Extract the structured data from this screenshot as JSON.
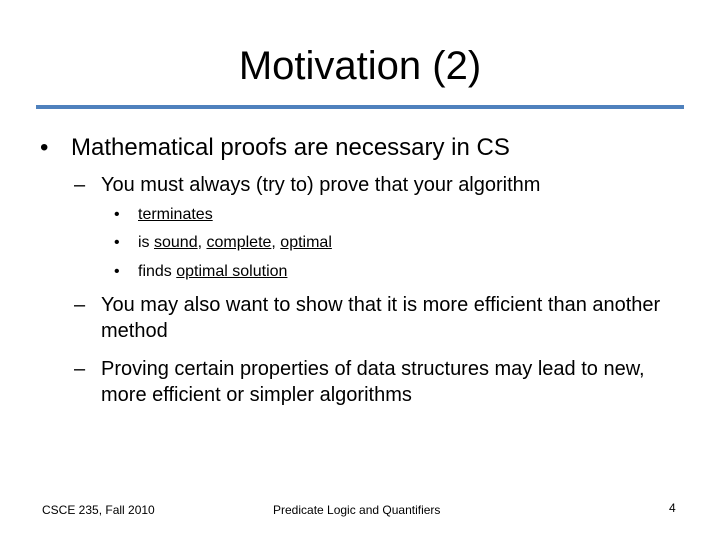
{
  "slide": {
    "title": "Motivation (2)",
    "accent_color": "#4f81bd",
    "bullet": {
      "text": "Mathematical proofs are necessary in CS",
      "subpoints": [
        {
          "text": "You must always (try to) prove that your algorithm",
          "items": [
            {
              "parts": [
                {
                  "text": "terminates",
                  "underline": true
                }
              ]
            },
            {
              "parts": [
                {
                  "text": "is ",
                  "underline": false
                },
                {
                  "text": "sound",
                  "underline": true
                },
                {
                  "text": ", ",
                  "underline": false
                },
                {
                  "text": "complete",
                  "underline": true
                },
                {
                  "text": ", ",
                  "underline": false
                },
                {
                  "text": "optimal",
                  "underline": true
                }
              ]
            },
            {
              "parts": [
                {
                  "text": "finds ",
                  "underline": false
                },
                {
                  "text": "optimal solution",
                  "underline": true
                }
              ]
            }
          ]
        },
        {
          "text": "You may also want to show that it is more efficient than another method"
        },
        {
          "text": "Proving certain properties of data structures may lead to new, more efficient or simpler algorithms"
        }
      ]
    }
  },
  "symbols": {
    "bullet": "•",
    "dash": "–"
  },
  "footer": {
    "left": "CSCE 235, Fall 2010",
    "center": "Predicate Logic and Quantifiers",
    "page_number": "4"
  }
}
